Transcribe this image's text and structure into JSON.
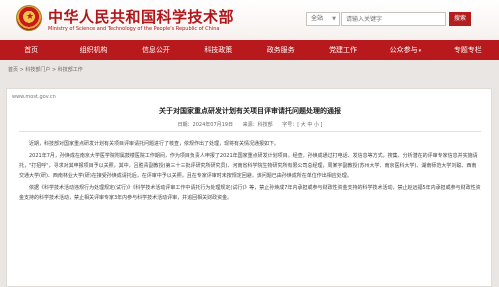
{
  "header": {
    "title_cn": "中华人民共和国科学技术部",
    "title_en": "Ministry of Science and Technology of the People's Republic of China",
    "site_select": "全站",
    "search_placeholder": "请输入关键字",
    "search_button": "搜索"
  },
  "nav": {
    "items": [
      {
        "label": "首页"
      },
      {
        "label": "组织机构"
      },
      {
        "label": "信息公开"
      },
      {
        "label": "科技政策"
      },
      {
        "label": "政务服务"
      },
      {
        "label": "党建工作"
      },
      {
        "label": "公众参与"
      },
      {
        "label": "专题专栏"
      }
    ]
  },
  "breadcrumb": {
    "text": "首页 > 科技部门户 > 科技部工作"
  },
  "article": {
    "url": "www.most.gov.cn",
    "title": "关于对国家重点研发计划有关项目评审请托问题处理的通报",
    "date": "日期：2024年07月19日",
    "source": "来源：科技部",
    "font_size": "字号：[ 大 中 小 ]",
    "paragraphs": [
      "近期，科技部对国家重点研发计划有关项目评审请托问题进行了核查，依规作出了处理，现将有关情况通报如下。",
      "2021年7月，孙焕成在南京大学医学院附属鼓楼医院工作期间，作为项目负责人申报了2021年国家重点研发计划项目。经查，孙焕成通过打电话、发信息等方式，搜集、分析潜在的评审专家信息并实施请托，\"打招呼\"，寻求对其申报项目予以关照，其中，吕胜青副教授(第三十三批评研究所研究员)、河南省科学院生物研究所有限公司总经理，周某宇副教授(苏州大学、南京医科大学)、湖南师范大学刘聪、西南交通大学(研)、西南林业大学(研)在接受孙焕成请托后，在评审中予以关照，且在专家评审时未按规定回避。该问题已由孙焕成所在单位作出相应处理。",
      "依据《科学技术活动违规行为处理规定(试行)》《科学技术活动评审工作中请托行为处理规定(试行)》等，禁止孙焕成7年内承担或参与财政性资金支持的科学技术活动，禁止赵远福5年内承担或参与财政性资金支持的科学技术活动，禁止相关评审专家3年内参与科学技术活动评审，并追回相关财政资金。"
    ]
  },
  "colors": {
    "brand_red": "#b8191c",
    "page_bg": "#e9e6e3"
  },
  "icons": {
    "emblem": "national-emblem-icon",
    "dropdown": "chevron-down-icon"
  }
}
